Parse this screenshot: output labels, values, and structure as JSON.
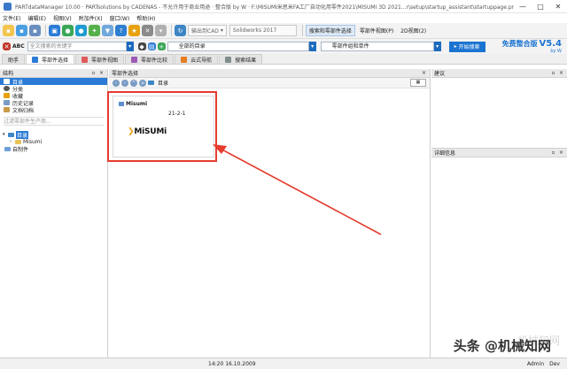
{
  "window": {
    "title": "PARTdataManager 10.00 · PARTsolutions by CADENAS - 不允许用于商业用途 · 整合版 by W · F:\\MISUMI米思米FA工厂自动化用零件2021\\MISUMI 3D 2021...r\\setup\\startup_assistant\\startuppage.prj",
    "minimize": "—",
    "maximize": "□",
    "close": "✕"
  },
  "menu": [
    "文件(E)",
    "编辑(E)",
    "视图(V)",
    "附加件(X)",
    "窗口(W)",
    "帮助(H)"
  ],
  "toolbar": {
    "export_cad": "输出到CAD",
    "solidworks": "Solidworks 2017",
    "search_select": "搜索和零部件选择",
    "part_view": "零部件视图(P)",
    "view_2d": "2D视图(2)"
  },
  "searchbar": {
    "abc": "ABC",
    "keyword_placeholder": "全文搜索的关键字",
    "catalog": "全部的目录",
    "combo": "零部件组和单件",
    "start_search": "开始搜索",
    "brand": "免费整合版",
    "version": "V5.4",
    "by": "by W"
  },
  "tabs": [
    {
      "label": "助手"
    },
    {
      "label": "零部件选择"
    },
    {
      "label": "零部件视图"
    },
    {
      "label": "零部件比较"
    },
    {
      "label": "云式导航"
    },
    {
      "label": "搜索结果"
    }
  ],
  "left_pane": {
    "title": "结构",
    "items": [
      "目录",
      "分类",
      "收藏",
      "历史记录",
      "文档归档"
    ],
    "filter_placeholder": "过滤零部件生产商...",
    "tree": {
      "root": "目录",
      "child": "Misumi",
      "own": "自制件"
    }
  },
  "center_pane": {
    "title": "零部件选择",
    "path": "目录",
    "card": {
      "title": "Misumi",
      "date": "21-2-1",
      "logo_mark": "❯",
      "logo_text": "MiSUMi"
    }
  },
  "right_pane": {
    "suggestion": "建议",
    "details": "详细信息"
  },
  "status": {
    "datetime": "14:20 16.10.2009",
    "user": "Admin",
    "mode": "Dev"
  },
  "watermark": {
    "text": "头条 @机械知网",
    "faint": "机械知网"
  },
  "colors": {
    "accent": "#1b73d1",
    "highlight": "#e53c2e",
    "selection": "#2b7bd6"
  }
}
